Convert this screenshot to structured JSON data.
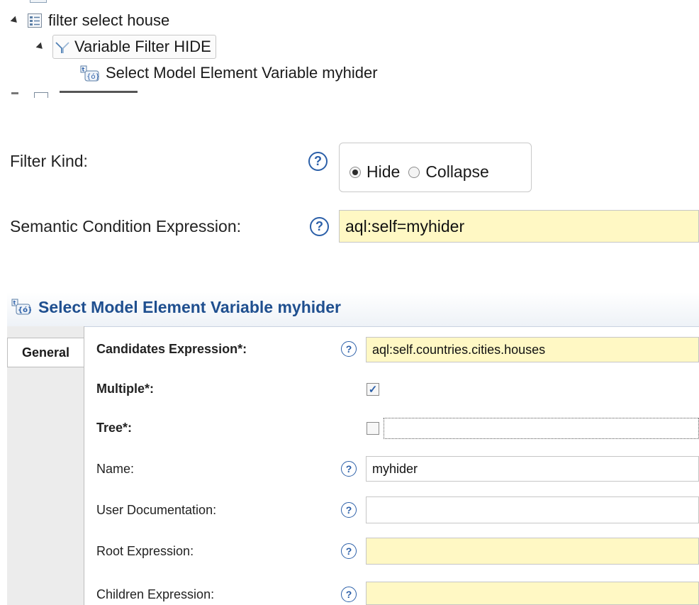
{
  "tree": {
    "items": [
      {
        "label": "filter select house"
      },
      {
        "label": "Variable Filter HIDE"
      },
      {
        "label": "Select Model Element Variable myhider"
      }
    ]
  },
  "filter_properties": {
    "filter_kind_label": "Filter Kind:",
    "filter_kind_options": [
      "Hide",
      "Collapse"
    ],
    "filter_kind_selected": "Hide",
    "semantic_condition_label": "Semantic Condition Expression:",
    "semantic_condition_value": "aql:self=myhider",
    "help_glyph": "?"
  },
  "variable_section": {
    "title": "Select Model Element Variable myhider",
    "tab_general": "General",
    "fields": {
      "candidates_label": "Candidates Expression*:",
      "candidates_value": "aql:self.countries.cities.houses",
      "multiple_label": "Multiple*:",
      "multiple_checked": true,
      "tree_label": "Tree*:",
      "tree_checked": false,
      "name_label": "Name:",
      "name_value": "myhider",
      "user_doc_label": "User Documentation:",
      "user_doc_value": "",
      "root_expr_label": "Root Expression:",
      "root_expr_value": "",
      "children_expr_label": "Children Expression:",
      "children_expr_value": ""
    }
  },
  "colors": {
    "required_field_bg": "#fff8c4",
    "help_icon": "#2b5fa8",
    "section_title": "#1f4f8f"
  }
}
